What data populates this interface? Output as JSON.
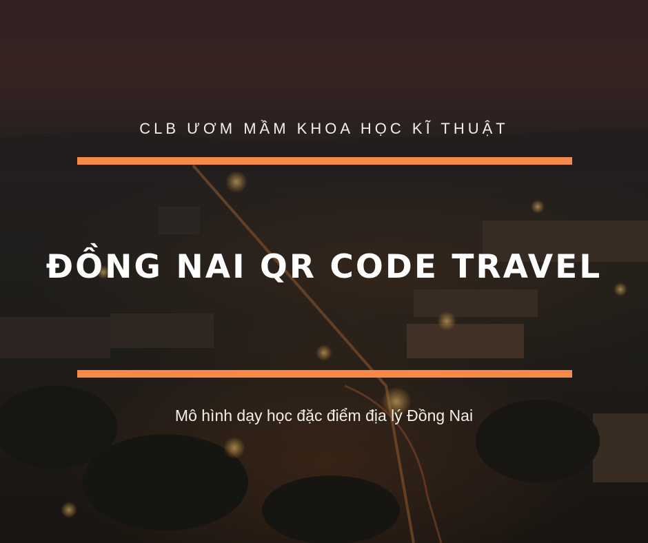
{
  "poster": {
    "top_text": "CLB ƯƠM MẦM KHOA HỌC KĨ THUẬT",
    "title": "ĐỒNG NAI QR CODE TRAVEL",
    "caption": "Mô hình dạy học đặc điểm địa lý Đồng Nai"
  },
  "colors": {
    "accent_bar": "#f7894a",
    "text": "#ffffff"
  }
}
